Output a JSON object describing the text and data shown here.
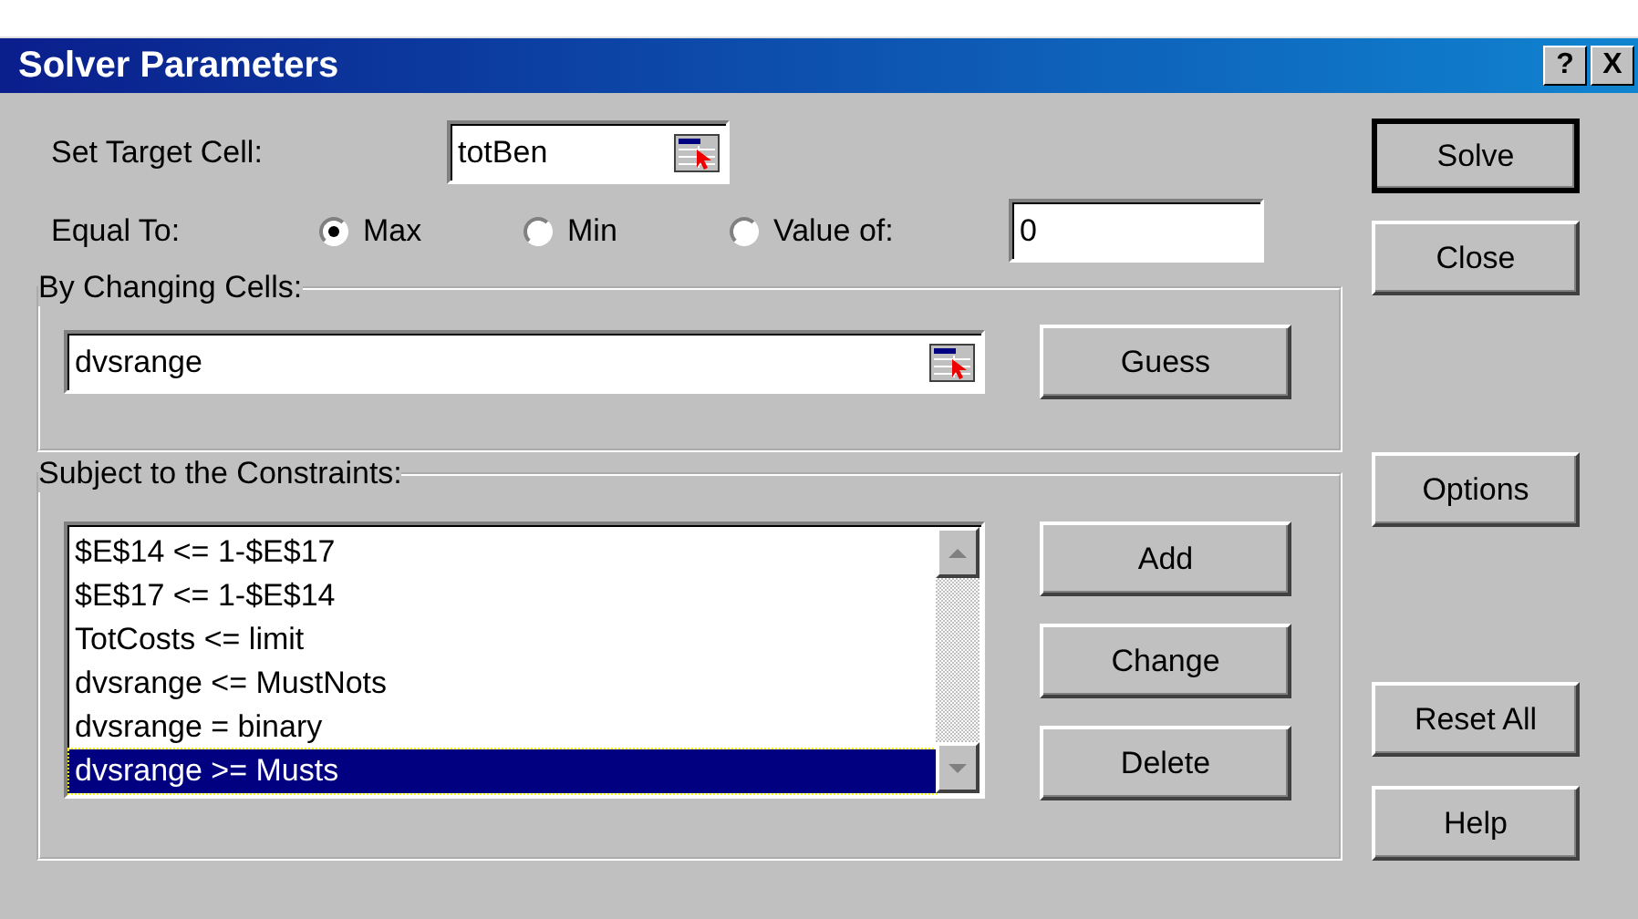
{
  "window": {
    "title": "Solver Parameters",
    "title_buttons": [
      "?",
      "X"
    ]
  },
  "target_cell": {
    "label": "Set Target Cell:",
    "value": "totBen"
  },
  "equal_to": {
    "label": "Equal To:",
    "options": [
      {
        "label": "Max",
        "selected": true
      },
      {
        "label": "Min",
        "selected": false
      },
      {
        "label": "Value of:",
        "selected": false
      }
    ],
    "value": "0"
  },
  "changing_cells": {
    "title": "By Changing Cells:",
    "value": "dvsrange",
    "button": "Guess"
  },
  "constraints": {
    "title": "Subject to the Constraints:",
    "items": [
      {
        "text": "$E$14 <= 1-$E$17",
        "selected": false
      },
      {
        "text": "$E$17 <= 1-$E$14",
        "selected": false
      },
      {
        "text": "TotCosts <= limit",
        "selected": false
      },
      {
        "text": "dvsrange <= MustNots",
        "selected": false
      },
      {
        "text": "dvsrange = binary",
        "selected": false
      },
      {
        "text": "dvsrange >= Musts",
        "selected": true
      }
    ],
    "buttons": [
      "Add",
      "Change",
      "Delete"
    ]
  },
  "side_buttons": [
    {
      "label": "Solve",
      "default": true
    },
    {
      "label": "Close",
      "default": false
    },
    {
      "label": "Options",
      "default": false
    },
    {
      "label": "Reset All",
      "default": false
    },
    {
      "label": "Help",
      "default": false
    }
  ]
}
